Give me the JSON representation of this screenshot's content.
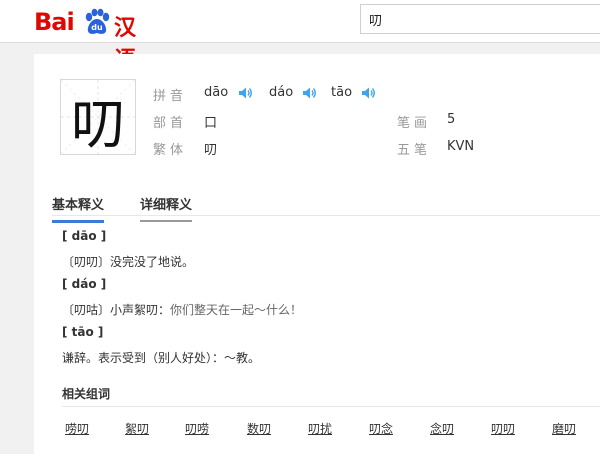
{
  "header": {
    "logo_text_left": "Bai",
    "logo_paw_text": "du",
    "logo_text_right": "汉语",
    "search_value": "叨"
  },
  "entry": {
    "character": "叨",
    "pinyin_label": "拼音",
    "pinyin": [
      "dāo",
      "dáo",
      "tāo"
    ],
    "radical_label": "部首",
    "radical": "口",
    "strokes_label": "笔画",
    "strokes": "5",
    "traditional_label": "繁体",
    "traditional": "叨",
    "wubi_label": "五笔",
    "wubi": "KVN"
  },
  "tabs": [
    {
      "label": "基本释义",
      "active": true
    },
    {
      "label": "详细释义",
      "active": false
    }
  ],
  "definitions": [
    {
      "pinyin": "[ dāo ]",
      "text": "〔叨叨〕没完没了地说。",
      "example": ""
    },
    {
      "pinyin": "[ dáo ]",
      "text": "〔叨咕〕小声絮叨：",
      "example": "你们整天在一起～什么！"
    },
    {
      "pinyin": "[ tāo ]",
      "text": "谦辞。表示受到（别人好处）：～教。",
      "example": ""
    }
  ],
  "related": {
    "title": "相关组词",
    "words": [
      "唠叨",
      "絮叨",
      "叨唠",
      "数叨",
      "叨扰",
      "叨念",
      "念叨",
      "叨叨",
      "磨叨"
    ]
  },
  "colors": {
    "brand_red": "#e10602",
    "speaker_blue": "#3fa5e8",
    "tab_active": "#3b7bd5"
  },
  "icons": {
    "speaker": "speaker-icon",
    "paw": "baidu-paw-icon"
  }
}
